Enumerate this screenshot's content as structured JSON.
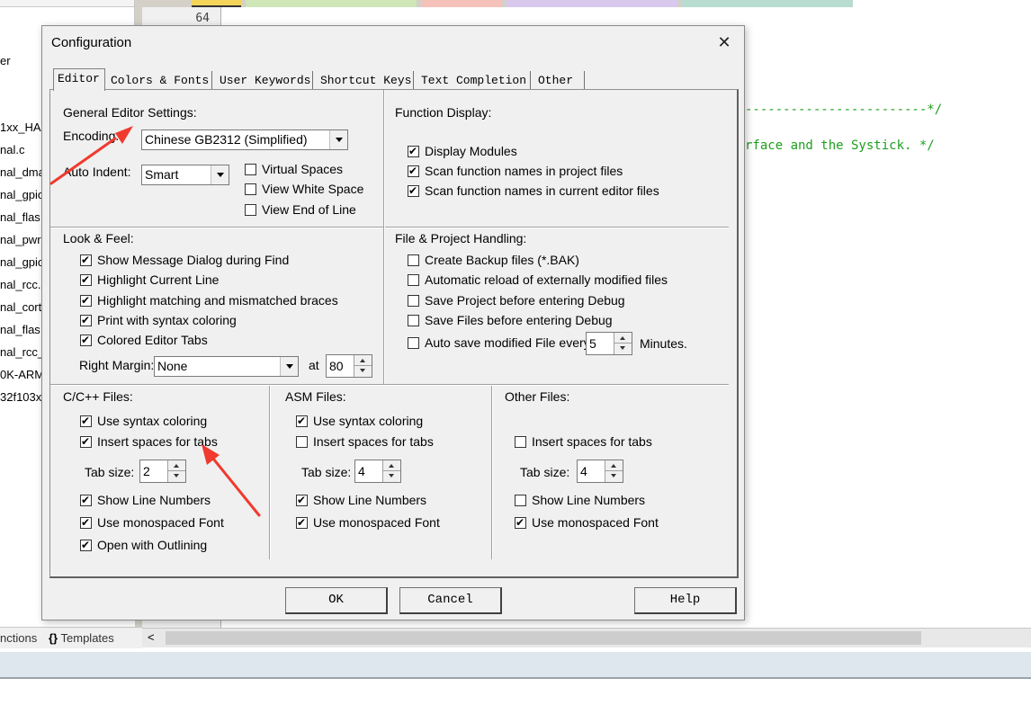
{
  "background": {
    "sidebar_files": [
      "er",
      "1xx_HA",
      "nal.c",
      "nal_dma",
      "nal_gpio",
      "nal_flas",
      "nal_pwr",
      "nal_gpio",
      "nal_rcc.",
      "nal_cort",
      "nal_flas",
      "nal_rcc_",
      "0K-ARM",
      "32f103x"
    ],
    "line_number": "64",
    "code_lines": [
      "------------------------*/",
      "rface and the Systick. */"
    ],
    "bottom_tabs": [
      "nctions",
      "Templates"
    ],
    "hscroll_left_arrow": "<"
  },
  "dialog": {
    "title": "Configuration",
    "close_symbol": "✕",
    "tabs": [
      "Editor",
      "Colors & Fonts",
      "User Keywords",
      "Shortcut Keys",
      "Text Completion",
      "Other"
    ],
    "general": {
      "title": "General Editor Settings:",
      "encoding_label": "Encoding:",
      "encoding_value": "Chinese GB2312 (Simplified)",
      "auto_indent_label": "Auto Indent:",
      "auto_indent_value": "Smart",
      "virtual_spaces": "Virtual Spaces",
      "view_white_space": "View White Space",
      "view_end_of_line": "View End of Line"
    },
    "function_display": {
      "title": "Function Display:",
      "display_modules": "Display Modules",
      "scan_project": "Scan function names in project files",
      "scan_editor": "Scan function names in current editor files"
    },
    "look_feel": {
      "title": "Look & Feel:",
      "show_message": "Show Message Dialog during Find",
      "highlight_line": "Highlight Current Line",
      "highlight_braces": "Highlight matching and mismatched braces",
      "print_syntax": "Print with syntax coloring",
      "colored_tabs": "Colored Editor Tabs",
      "right_margin_label": "Right Margin:",
      "right_margin_value": "None",
      "at_label": "at",
      "at_value": "80"
    },
    "file_project": {
      "title": "File & Project Handling:",
      "create_backup": "Create Backup files (*.BAK)",
      "auto_reload": "Automatic reload of externally modified files",
      "save_project": "Save Project before entering Debug",
      "save_files": "Save Files before entering Debug",
      "auto_save": "Auto save modified File every",
      "auto_save_value": "5",
      "minutes_label": "Minutes."
    },
    "cpp": {
      "title": "C/C++ Files:",
      "syntax": "Use syntax coloring",
      "insert_spaces": "Insert spaces for tabs",
      "tab_size_label": "Tab size:",
      "tab_size": "2",
      "line_numbers": "Show Line Numbers",
      "monospaced": "Use monospaced Font",
      "outlining": "Open with Outlining"
    },
    "asm": {
      "title": "ASM Files:",
      "syntax": "Use syntax coloring",
      "insert_spaces": "Insert spaces for tabs",
      "tab_size_label": "Tab size:",
      "tab_size": "4",
      "line_numbers": "Show Line Numbers",
      "monospaced": "Use monospaced Font"
    },
    "other": {
      "title": "Other Files:",
      "insert_spaces": "Insert spaces for tabs",
      "tab_size_label": "Tab size:",
      "tab_size": "4",
      "line_numbers": "Show Line Numbers",
      "monospaced": "Use monospaced Font"
    },
    "buttons": {
      "ok": "OK",
      "cancel": "Cancel",
      "help": "Help"
    }
  },
  "colors": {
    "arrow": "#f03a2e",
    "code_comment": "#1e9e1e"
  }
}
